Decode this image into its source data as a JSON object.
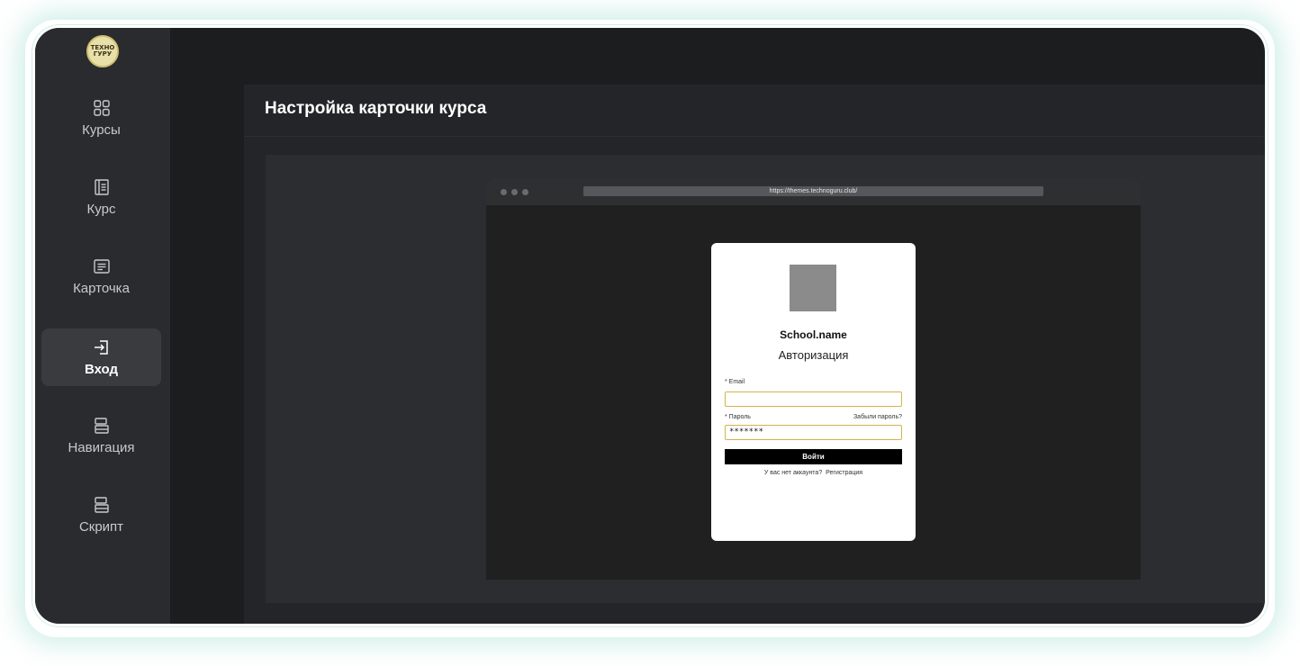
{
  "sidebar": {
    "logo_text": "ТЕХНО ГУРУ",
    "items": [
      {
        "label": "Курсы",
        "icon": "grid-icon"
      },
      {
        "label": "Курс",
        "icon": "course-page-icon"
      },
      {
        "label": "Карточка",
        "icon": "card-icon"
      },
      {
        "label": "Вход",
        "icon": "login-icon",
        "active": true
      },
      {
        "label": "Навигация",
        "icon": "navigation-icon"
      },
      {
        "label": "Скрипт",
        "icon": "script-icon"
      }
    ]
  },
  "page": {
    "title": "Настройка карточки курса"
  },
  "preview": {
    "url": "https://themes.technoguru.club/",
    "card": {
      "school_name": "School.name",
      "auth_title": "Авторизация",
      "email_label": "* Email",
      "email_value": "",
      "password_label": "* Пароль",
      "forgot_label": "Забыли пароль?",
      "password_value": "*******",
      "login_button": "Войти",
      "no_account": "У вас нет аккаунта?",
      "register_link": "Регистрация"
    }
  },
  "colors": {
    "accent_border": "#d4b24a",
    "sidebar_bg": "#2a2b2e",
    "active_bg": "#3a3b3f"
  }
}
